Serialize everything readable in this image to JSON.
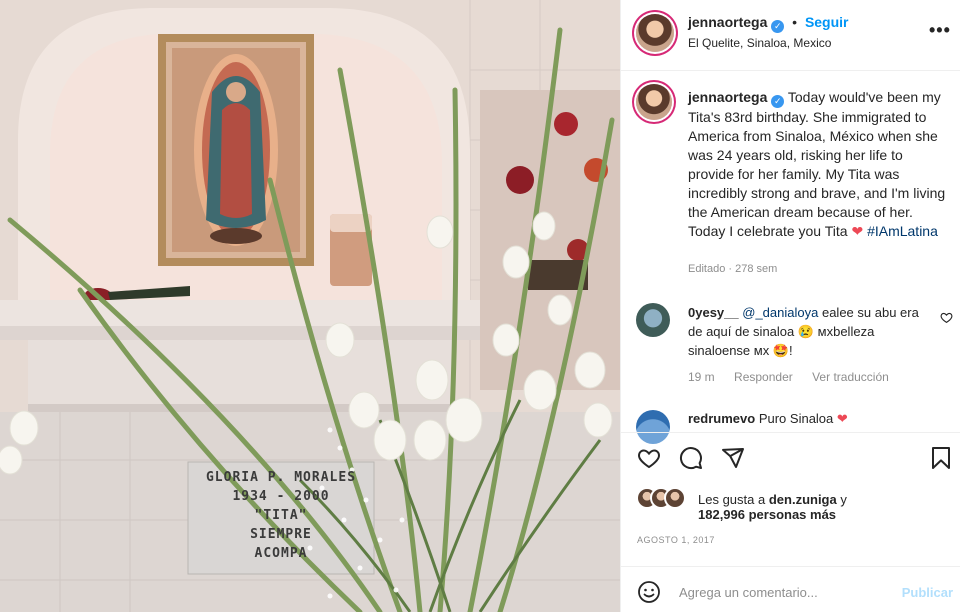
{
  "post": {
    "username": "jennaortega",
    "verified_icon": "verified-badge-icon",
    "follow_label": "Seguir",
    "separator": "•",
    "location": "El Quelite, Sinaloa, Mexico",
    "more_icon": "more-options-icon",
    "more_label": "•••"
  },
  "photo": {
    "plaque_lines": [
      "GLORIA P. MORALES",
      "1934 - 2000",
      "\"TITA\"",
      "SIEMPRE    ",
      "ACOMPA    "
    ]
  },
  "caption": {
    "username": "jennaortega",
    "text_before_heart": "Today would've been my Tita's 83rd birthday. She immigrated to America from Sinaloa, México when she was 24 years old, risking her life to provide for her family. My Tita was incredibly strong and brave, and I'm living the American dream because of her. Today I celebrate you Tita",
    "heart": "❤",
    "hashtag": "#IAmLatina",
    "meta": "Editado · 278 sem"
  },
  "comments": [
    {
      "username": "0yesy__",
      "mention": "@_danialoya",
      "text": "ealee su abu era de aquí de sinaloa 😢 ᴍxbelleza sinaloense ᴍx 🤩!",
      "time": "19 m",
      "reply_label": "Responder",
      "translate_label": "Ver traducción",
      "like_icon": "heart-outline-icon"
    },
    {
      "username": "redrumevo",
      "text": "Puro Sinaloa",
      "heart": "❤"
    }
  ],
  "actions": {
    "like_icon": "heart-outline-icon",
    "comment_icon": "comment-bubble-icon",
    "share_icon": "paper-plane-icon",
    "save_icon": "bookmark-icon"
  },
  "likes": {
    "prefix": "Les gusta a",
    "top_user": "den.zuniga",
    "and": "y",
    "others": "182,996 personas más"
  },
  "date": "AGOSTO 1, 2017",
  "add_comment": {
    "emoji_icon": "emoji-smile-icon",
    "placeholder": "Agrega un comentario...",
    "publish_label": "Publicar"
  },
  "colors": {
    "accent_blue": "#0095f6",
    "verified_blue": "#3897f0",
    "heart_red": "#ed4956",
    "hashtag_blue": "#00376b",
    "muted_gray": "#8e8e8e",
    "publish_disabled": "#b2dffc"
  }
}
